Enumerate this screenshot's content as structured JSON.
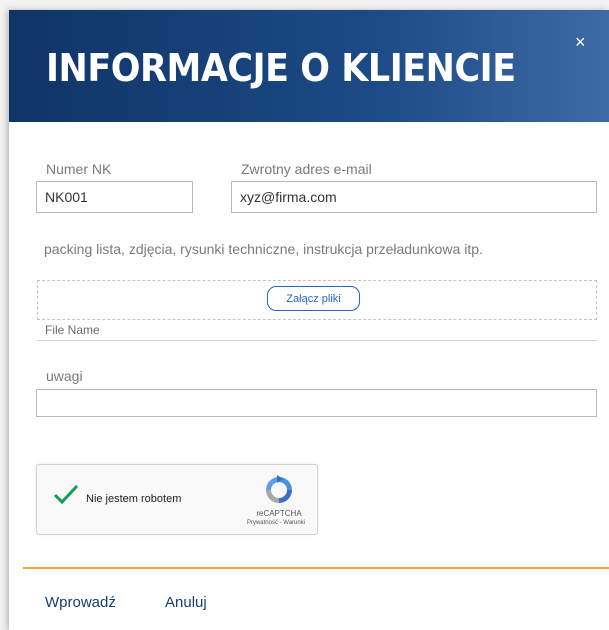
{
  "modal": {
    "title": "INFORMACJE O KLIENCIE",
    "close_glyph": "×"
  },
  "form": {
    "nk_number": {
      "label": "Numer NK",
      "value": "NK001"
    },
    "return_email": {
      "label": "Zwrotny adres e-mail",
      "value": "xyz@firma.com"
    },
    "attachments": {
      "hint": "packing lista, zdjęcia, rysunki techniczne, instrukcja przeładunkowa itp.",
      "attach_label": "Załącz pliki",
      "file_name_header": "File Name"
    },
    "notes": {
      "label": "uwagi",
      "value": ""
    }
  },
  "captcha": {
    "label": "Nie jestem robotem",
    "checked": true,
    "brand": "reCAPTCHA",
    "links": "Prywatność - Warunki"
  },
  "footer": {
    "submit_label": "Wprowadź",
    "cancel_label": "Anuluj"
  },
  "colors": {
    "header_dark": "#0f3466",
    "header_light": "#3e6aa6",
    "accent_orange": "#f2a43c",
    "link_blue": "#2767c7",
    "check_green": "#0f9d58"
  }
}
